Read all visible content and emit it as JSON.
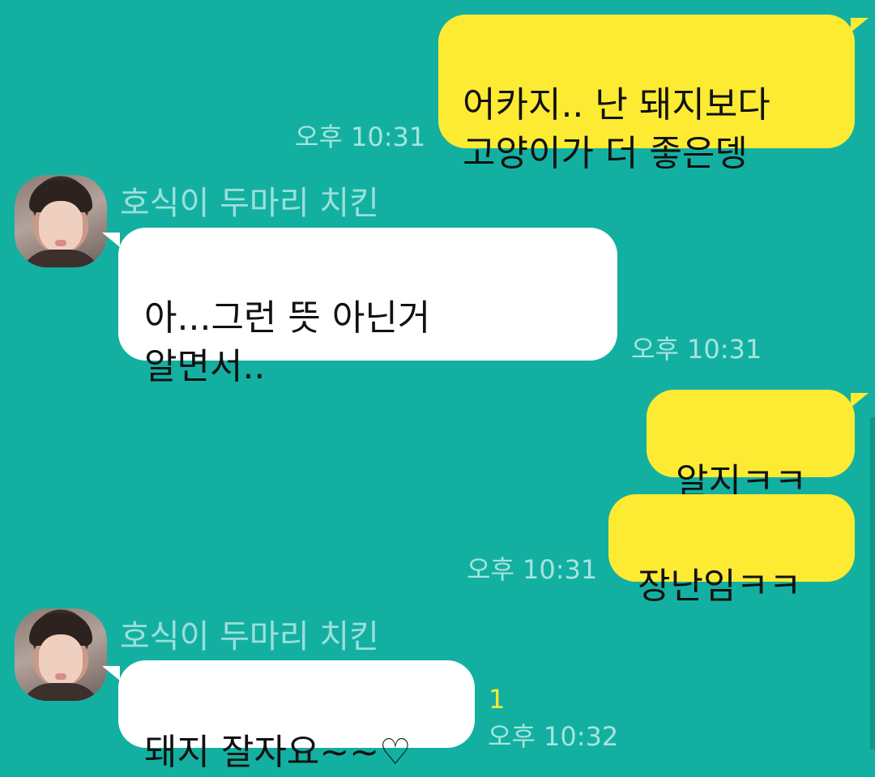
{
  "messages": [
    {
      "id": "m1",
      "from": "me",
      "text": "어카지.. 난 돼지보다\n고양이가 더 좋은뎅",
      "time": "오후 10:31"
    },
    {
      "id": "m2",
      "from": "them",
      "sender": "호식이 두마리 치킨",
      "text": "아...그런 뜻 아닌거\n알면서..",
      "time": "오후 10:31"
    },
    {
      "id": "m3",
      "from": "me",
      "text": "알지ㅋㅋ"
    },
    {
      "id": "m4",
      "from": "me",
      "text": "장난임ㅋㅋ",
      "time": "오후 10:31"
    },
    {
      "id": "m5",
      "from": "them",
      "sender": "호식이 두마리 치킨",
      "text": "돼지 잘자요~~♡",
      "time": "오후 10:32",
      "unread": "1"
    }
  ],
  "colors": {
    "background": "#13b0a2",
    "my_bubble": "#fdeb33",
    "their_bubble": "#ffffff",
    "time_text": "#a7e4dd",
    "sender_text": "#9be0d9"
  }
}
